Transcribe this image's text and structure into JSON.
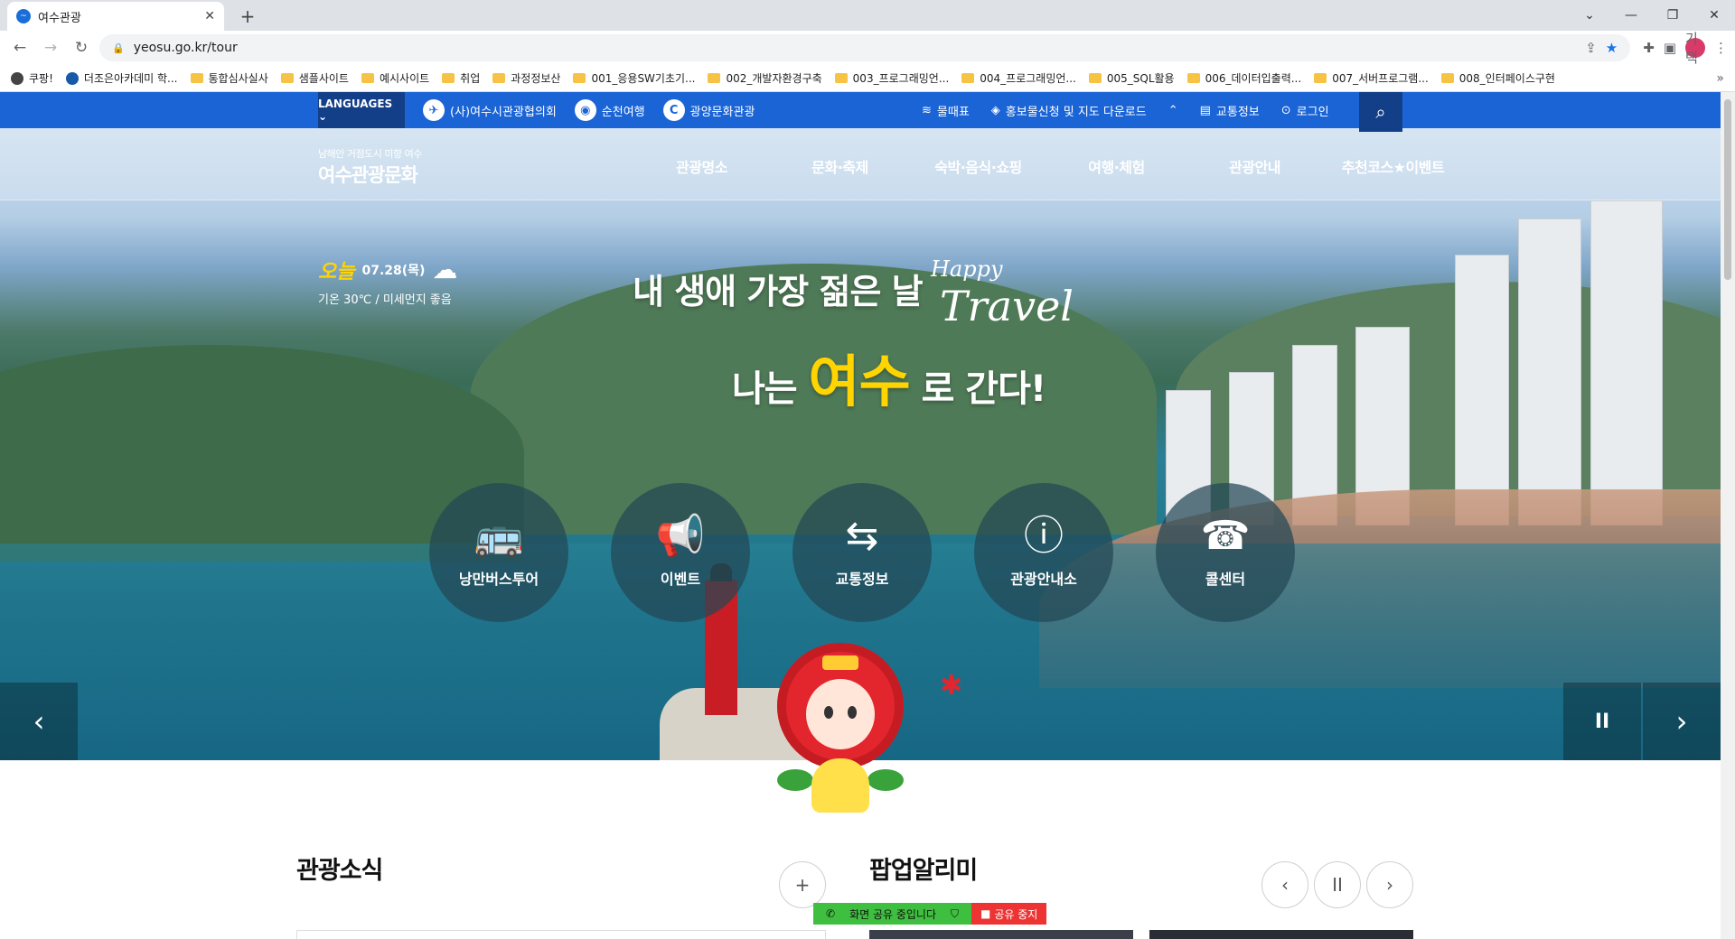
{
  "browser": {
    "tab_title": "여수관광",
    "url": "yeosu.go.kr/tour",
    "profile_label": "기택",
    "bookmarks": [
      {
        "label": "쿠팡!",
        "type": "site"
      },
      {
        "label": "더조은아카데미 학...",
        "type": "site"
      },
      {
        "label": "통합심사실사",
        "type": "folder"
      },
      {
        "label": "샘플사이트",
        "type": "folder"
      },
      {
        "label": "예시사이트",
        "type": "folder"
      },
      {
        "label": "취업",
        "type": "folder"
      },
      {
        "label": "과정정보산",
        "type": "folder"
      },
      {
        "label": "001_응용SW기초기...",
        "type": "folder"
      },
      {
        "label": "002_개발자환경구축",
        "type": "folder"
      },
      {
        "label": "003_프로그래밍언...",
        "type": "folder"
      },
      {
        "label": "004_프로그래밍언...",
        "type": "folder"
      },
      {
        "label": "005_SQL활용",
        "type": "folder"
      },
      {
        "label": "006_데이터입출력...",
        "type": "folder"
      },
      {
        "label": "007_서버프로그램...",
        "type": "folder"
      },
      {
        "label": "008_인터페이스구현",
        "type": "folder"
      }
    ]
  },
  "topbar": {
    "languages": "LANGUAGES ⌄",
    "links": [
      "(사)여수시관광협의회",
      "순천여행",
      "광양문화관광"
    ],
    "right": [
      "물때표",
      "홍보물신청 및 지도 다운로드",
      "교통정보",
      "로그인"
    ],
    "colors": {
      "bar": "#1a64d6",
      "dark": "#123f88"
    }
  },
  "header": {
    "logo_sub": "남해안 거점도시 미항 여수",
    "logo_main": "여수관광문화",
    "menu": [
      "관광명소",
      "문화·축제",
      "숙박·음식·쇼핑",
      "여행·체험",
      "관광안내",
      "추천코스★이벤트"
    ]
  },
  "weather": {
    "today_label": "오늘",
    "date": "07.28(목)",
    "detail": "기온 30℃ / 미세먼지 좋음"
  },
  "slogan": {
    "line1": "내 생애 가장 젊은 날",
    "happy": "Happy",
    "travel": "Travel",
    "line2_pre": "나는",
    "line2_highlight": "여수",
    "line2_post": "로 간다!"
  },
  "quick_menu": [
    {
      "label": "낭만버스투어",
      "icon": "bus-icon"
    },
    {
      "label": "이벤트",
      "icon": "megaphone-icon"
    },
    {
      "label": "교통정보",
      "icon": "signpost-icon"
    },
    {
      "label": "관광안내소",
      "icon": "info-icon"
    },
    {
      "label": "콜센터",
      "icon": "phone-icon"
    }
  ],
  "sections": {
    "news_title": "관광소식",
    "popup_title": "팝업알리미"
  },
  "share_bar": {
    "sharing": "화면 공유 중입니다",
    "stop": "공유 중지"
  }
}
